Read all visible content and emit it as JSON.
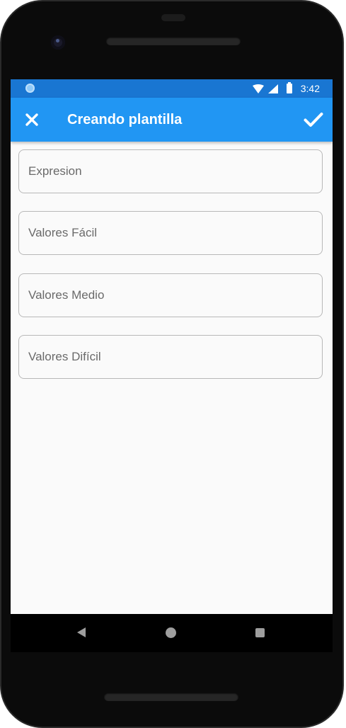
{
  "status_bar": {
    "time": "3:42"
  },
  "app_bar": {
    "title": "Creando plantilla",
    "close_icon": "close-icon",
    "confirm_icon": "check-icon"
  },
  "form": {
    "fields": [
      {
        "placeholder": "Expresion",
        "value": ""
      },
      {
        "placeholder": "Valores Fácil",
        "value": ""
      },
      {
        "placeholder": "Valores Medio",
        "value": ""
      },
      {
        "placeholder": "Valores Difícil",
        "value": ""
      }
    ]
  },
  "nav": {
    "back_icon": "back-triangle-icon",
    "home_icon": "home-circle-icon",
    "recents_icon": "recents-square-icon"
  },
  "colors": {
    "status_bar": "#1976d2",
    "app_bar": "#2196f3",
    "background": "#fafafa",
    "field_border": "#b8b8b8"
  }
}
